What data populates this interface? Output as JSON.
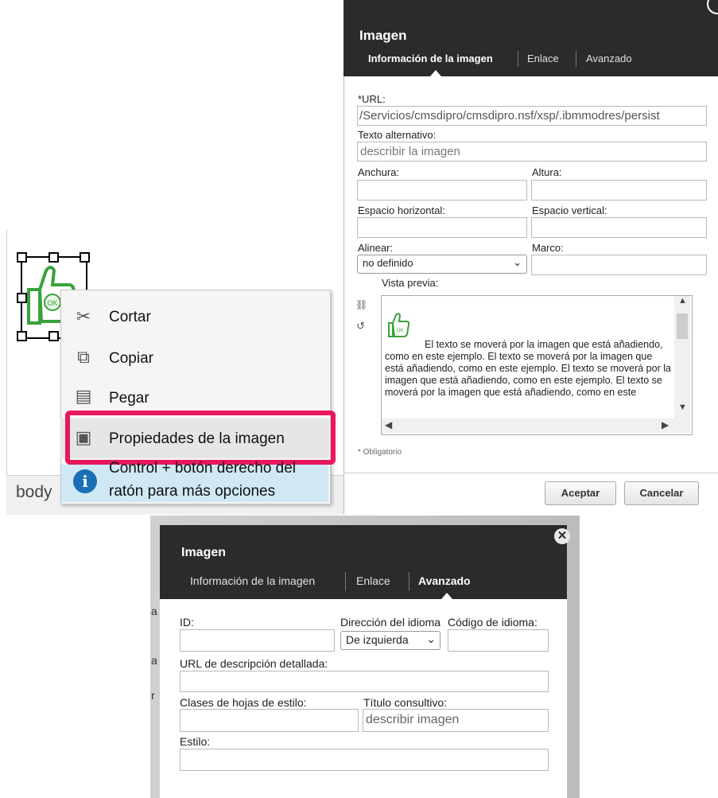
{
  "editor": {
    "status_path": "body",
    "context_menu": {
      "items": [
        {
          "label": "Cortar",
          "icon": "scissors-icon",
          "glyph": "✂"
        },
        {
          "label": "Copiar",
          "icon": "copy-icon",
          "glyph": "⧉"
        },
        {
          "label": "Pegar",
          "icon": "paste-icon",
          "glyph": "▤"
        },
        {
          "label": "Propiedades de la imagen",
          "icon": "image-properties-icon",
          "glyph": "▣"
        }
      ],
      "tip_line1": "Control + botón derecho del",
      "tip_line2": "ratón para más opciones"
    },
    "thumb_badge": "OK"
  },
  "dialog_info": {
    "title": "Imagen",
    "tabs": [
      "Información de la imagen",
      "Enlace",
      "Avanzado"
    ],
    "active_tab": "Información de la imagen",
    "url_label": "*URL:",
    "url_value": "/Servicios/cmsdipro/cmsdipro.nsf/xsp/.ibmmodres/persist",
    "alt_label": "Texto alternativo:",
    "alt_value": "describir la imagen",
    "width_label": "Anchura:",
    "height_label": "Altura:",
    "hspace_label": "Espacio horizontal:",
    "vspace_label": "Espacio vertical:",
    "align_label": "Alinear:",
    "align_value": "no definido",
    "border_label": "Marco:",
    "preview_label": "Vista previa:",
    "preview_text": "El texto se moverá por la imagen que está añadiendo, como en este ejemplo. El texto se moverá por la imagen que está añadiendo, como en este ejemplo. El texto se moverá por la imagen que está añadiendo, como en este ejemplo. El texto se moverá por la imagen que está añadiendo, como en este",
    "preview_badge": "OK",
    "required_note": "* Obligatorio",
    "ok_button": "Aceptar",
    "cancel_button": "Cancelar"
  },
  "dialog_adv": {
    "title": "Imagen",
    "tabs": [
      "Información de la imagen",
      "Enlace",
      "Avanzado"
    ],
    "active_tab": "Avanzado",
    "id_label": "ID:",
    "lang_dir_label": "Dirección del idioma",
    "lang_dir_value": "De izquierda",
    "lang_code_label": "Código de idioma:",
    "longdesc_label": "URL de descripción detallada:",
    "classes_label": "Clases de hojas de estilo:",
    "tooltip_label": "Título consultivo:",
    "tooltip_value": "describir imagen",
    "style_label": "Estilo:"
  }
}
